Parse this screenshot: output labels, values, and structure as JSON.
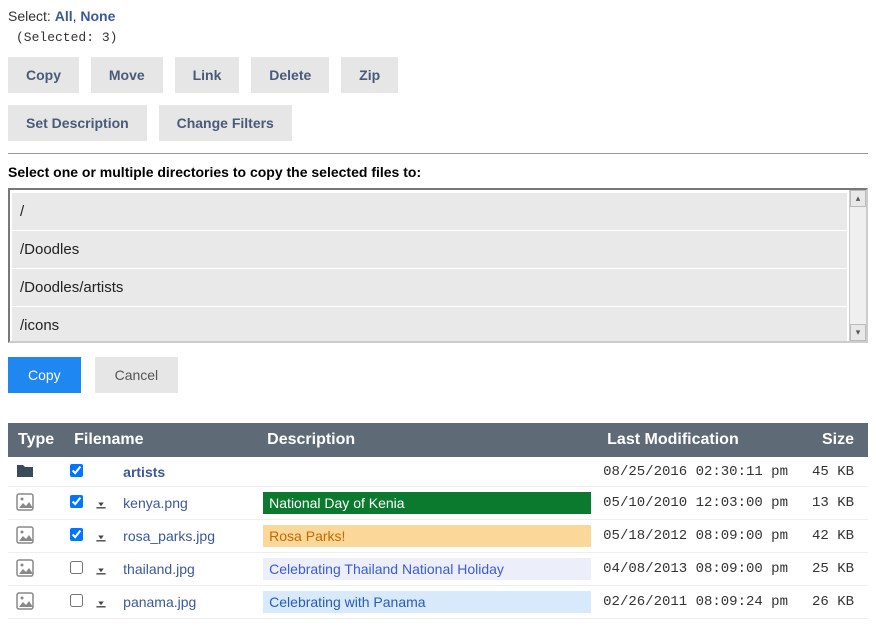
{
  "select": {
    "label": "Select:",
    "all": "All",
    "none": "None",
    "selected_text": "(Selected: 3)"
  },
  "toolbar1": {
    "copy": "Copy",
    "move": "Move",
    "link": "Link",
    "delete": "Delete",
    "zip": "Zip"
  },
  "toolbar2": {
    "set_description": "Set Description",
    "change_filters": "Change Filters"
  },
  "copy_panel": {
    "prompt": "Select one or multiple directories to copy the selected files to:",
    "dirs": [
      "/",
      "/Doodles",
      "/Doodles/artists",
      "/icons"
    ],
    "copy_btn": "Copy",
    "cancel_btn": "Cancel"
  },
  "table": {
    "headers": {
      "type": "Type",
      "filename": "Filename",
      "description": "Description",
      "last_mod": "Last Modification",
      "size": "Size"
    },
    "rows": [
      {
        "icon": "folder",
        "checked": true,
        "download": false,
        "filename": "artists",
        "bold": true,
        "description": "",
        "desc_bg": "",
        "desc_color": "",
        "last_mod": "08/25/2016 02:30:11 pm",
        "size": "45 KB"
      },
      {
        "icon": "image",
        "checked": true,
        "download": true,
        "filename": "kenya.png",
        "bold": false,
        "description": "National Day of Kenia",
        "desc_bg": "#0b7a2f",
        "desc_color": "#ffffff",
        "last_mod": "05/10/2010 12:03:00 pm",
        "size": "13 KB"
      },
      {
        "icon": "image",
        "checked": true,
        "download": true,
        "filename": "rosa_parks.jpg",
        "bold": false,
        "description": "Rosa Parks!",
        "desc_bg": "#fcd79a",
        "desc_color": "#c06a00",
        "last_mod": "05/18/2012 08:09:00 pm",
        "size": "42 KB"
      },
      {
        "icon": "image",
        "checked": false,
        "download": true,
        "filename": "thailand.jpg",
        "bold": false,
        "description": "Celebrating Thailand National Holiday",
        "desc_bg": "#eceefa",
        "desc_color": "#3b5bd9",
        "last_mod": "04/08/2013 08:09:00 pm",
        "size": "25 KB"
      },
      {
        "icon": "image",
        "checked": false,
        "download": true,
        "filename": "panama.jpg",
        "bold": false,
        "description": "Celebrating with Panama",
        "desc_bg": "#d7e9fb",
        "desc_color": "#2a5db0",
        "last_mod": "02/26/2011 08:09:24 pm",
        "size": "26 KB"
      }
    ]
  }
}
